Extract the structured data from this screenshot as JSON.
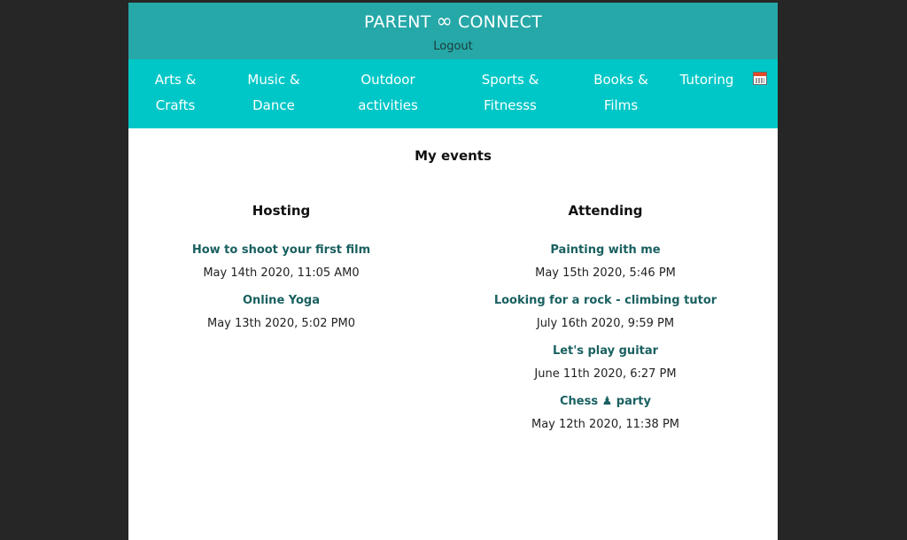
{
  "header": {
    "brand_left": "PARENT",
    "brand_symbol": "∞",
    "brand_right": "CONNECT",
    "logout_label": "Logout"
  },
  "nav": {
    "items": [
      {
        "line1": "Arts &",
        "line2": "Crafts"
      },
      {
        "line1": "Music &",
        "line2": "Dance"
      },
      {
        "line1": "Outdoor",
        "line2": "activities"
      },
      {
        "line1": "Sports &",
        "line2": "Fitnesss"
      },
      {
        "line1": "Books &",
        "line2": "Films"
      },
      {
        "line1": "Tutoring",
        "line2": ""
      }
    ],
    "calendar_icon": "calendar-icon"
  },
  "main": {
    "title": "My events",
    "hosting": {
      "title": "Hosting",
      "events": [
        {
          "title": "How to shoot your first film",
          "date": "May 14th 2020, 11:05 AM0"
        },
        {
          "title": "Online Yoga",
          "date": "May 13th 2020, 5:02 PM0"
        }
      ]
    },
    "attending": {
      "title": "Attending",
      "events": [
        {
          "title": "Painting with me",
          "date": "May 15th 2020, 5:46 PM"
        },
        {
          "title": "Looking for a rock - climbing tutor",
          "date": "July 16th 2020, 9:59 PM"
        },
        {
          "title": "Let's play guitar",
          "date": "June 11th 2020, 6:27 PM"
        },
        {
          "title": "Chess ♟ party",
          "date": "May 12th 2020, 11:38 PM"
        }
      ]
    }
  },
  "colors": {
    "topbar": "#26a8a8",
    "navbar": "#00c7c7",
    "link": "#1a6060",
    "background": "#262626"
  }
}
